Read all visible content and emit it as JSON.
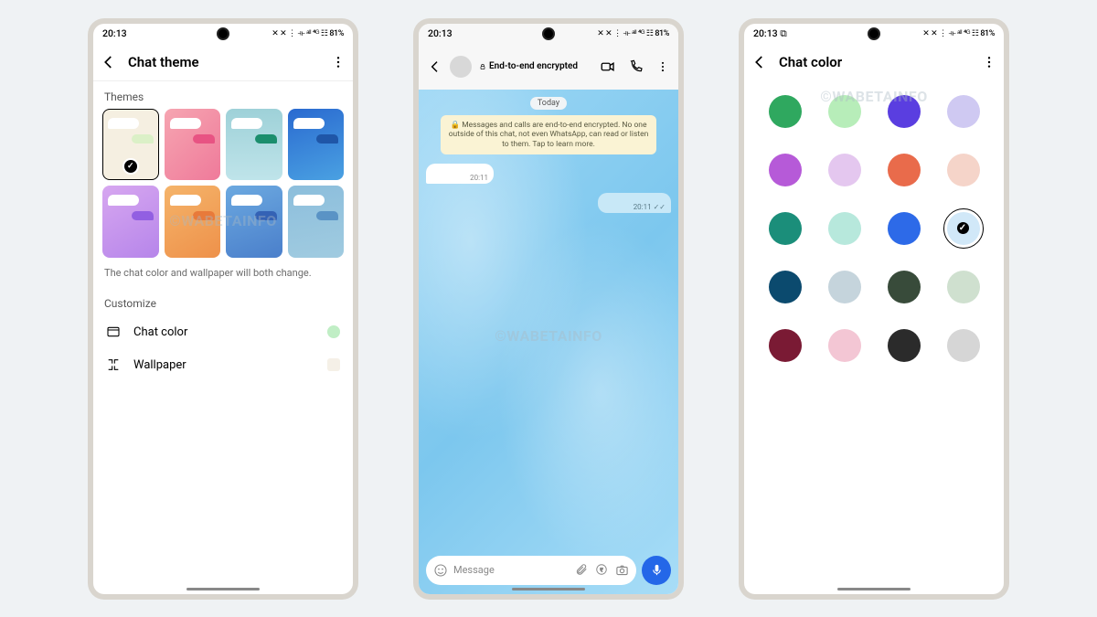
{
  "status": {
    "time": "20:13",
    "right": "✕ ✕ ⋮ ⟛ ᵃˡˡ ⁴ᴳ ☷ 81%"
  },
  "watermark": "©WABETAINFO",
  "phone1": {
    "title": "Chat theme",
    "themes_label": "Themes",
    "themes": [
      {
        "bg": "#f5efe1",
        "out": "#dbf0c7",
        "selected": true
      },
      {
        "bg": "linear-gradient(135deg,#f6a5b1,#ef7a9a)",
        "out": "#e85383"
      },
      {
        "bg": "linear-gradient(180deg,#9ed1d8,#bfe4ea)",
        "out": "#1b8e6d"
      },
      {
        "bg": "linear-gradient(160deg,#2a6ad0,#4aa1e2)",
        "out": "#1f56a8"
      },
      {
        "bg": "linear-gradient(150deg,#d7a7f0,#b685ea)",
        "out": "#925fe2"
      },
      {
        "bg": "linear-gradient(150deg,#f5b46a,#ee914a)",
        "out": "#e87a3a"
      },
      {
        "bg": "linear-gradient(160deg,#6ca9e0,#4a7fcb)",
        "out": "#3462b5"
      },
      {
        "bg": "linear-gradient(170deg,#8cbedc,#a0cbe0)",
        "out": "#5a93c5"
      }
    ],
    "caption": "The chat color and wallpaper will both change.",
    "customize_label": "Customize",
    "chat_color_label": "Chat color",
    "chat_color_swatch": "#c0eec5",
    "wallpaper_label": "Wallpaper"
  },
  "phone2": {
    "header_title": "End-to-end encrypted",
    "date": "Today",
    "notice": "🔒 Messages and calls are end-to-end encrypted. No one outside of this chat, not even WhatsApp, can read or listen to them. Tap to learn more.",
    "msg_in_time": "20:11",
    "msg_out_time": "20:11 ✓✓",
    "placeholder": "Message"
  },
  "phone3": {
    "title": "Chat color",
    "colors": [
      "#2fa85f",
      "#b7edb9",
      "#5a3ee0",
      "#cfc9f2",
      "#b65ad8",
      "#e4c7ef",
      "#e96b4b",
      "#f5d4c9",
      "#1b8e7a",
      "#b7e8dc",
      "#2d6ae8",
      "#d1e8f8",
      "#0b4a6e",
      "#c5d4dc",
      "#384b3a",
      "#cfe0cf",
      "#7a1a34",
      "#f3c6d4",
      "#2b2b2b",
      "#d6d6d6"
    ],
    "selected_index": 11
  }
}
